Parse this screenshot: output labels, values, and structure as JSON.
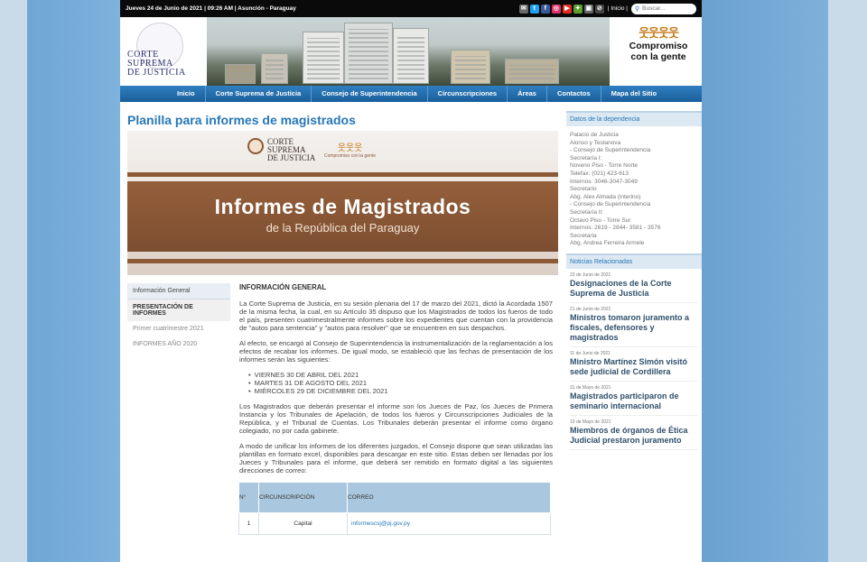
{
  "topbar": {
    "date": "Jueves 24 de Junio de 2021 | 09:26 AM | Asunción - Paraguay",
    "inicio": "| Inicio |",
    "search_placeholder": "Buscar..."
  },
  "social_icons": [
    {
      "name": "mail-icon",
      "color": "#6a6a6a",
      "glyph": "✉"
    },
    {
      "name": "twitter-icon",
      "color": "#1da1f2",
      "glyph": "t"
    },
    {
      "name": "facebook-icon",
      "color": "#3b5998",
      "glyph": "f"
    },
    {
      "name": "instagram-icon",
      "color": "#e1306c",
      "glyph": "◎"
    },
    {
      "name": "youtube-icon",
      "color": "#e52d27",
      "glyph": "▶"
    },
    {
      "name": "app-icon",
      "color": "#5aa02c",
      "glyph": "✦"
    },
    {
      "name": "camera-icon",
      "color": "#666666",
      "glyph": "▣"
    },
    {
      "name": "link-icon",
      "color": "#444444",
      "glyph": "⊘"
    }
  ],
  "header": {
    "logo_line1": "CORTE",
    "logo_line2": "SUPREMA",
    "logo_line3": "DE JUSTICIA",
    "slogan_line1": "Compromiso",
    "slogan_line2": "con la gente"
  },
  "nav": {
    "items": [
      "Inicio",
      "Corte Suprema de Justicia",
      "Consejo de Superintendencia",
      "Circunscripciones",
      "Áreas",
      "Contactos",
      "Mapa del Sitio"
    ]
  },
  "page_title": "Planilla para informes de magistrados",
  "banner": {
    "logo_line1": "CORTE",
    "logo_line2": "SUPREMA",
    "logo_line3": "DE JUSTICIA",
    "slogan": "Compromiso con la gente",
    "heading": "Informes de Magistrados",
    "subheading": "de la República del Paraguay"
  },
  "left_menu": [
    "Información General",
    "PRESENTACIÓN DE INFORMES",
    "Primer cuatrimestre 2021",
    "INFORMES AÑO 2020"
  ],
  "content": {
    "heading": "INFORMACIÓN GENERAL",
    "p1": "La Corte Suprema de Justicia, en su sesión plenaria del 17 de marzo del 2021, dictó la Acordada 1507 de la misma fecha, la cual, en su Artículo 35 dispuso que los Magistrados de todos los fueros de todo el país, presenten cuatrimestralmente informes sobre los expedientes que cuentan con la providencia de \"autos para sentencia\" y \"autos para resolver\" que se encuentren en sus despachos.",
    "p2": "Al efecto, se encargó al Consejo de Superintendencia la instrumentalización de la reglamentación a los efectos de recabar los informes. De igual modo, se estableció que las fechas de presentación de los informes serán las siguientes:",
    "dates": [
      "VIERNES 30 DE ABRIL DEL 2021",
      "MARTES 31 DE AGOSTO DEL 2021",
      "MIÉRCOLES 29 DE DICIEMBRE DEL 2021"
    ],
    "p3": "Los Magistrados que deberán presentar el informe son los Jueces de Paz, los Jueces de Primera Instancia y los Tribunales de Apelación, de todos los fueros y Circunscripciones Judiciales de la República, y el Tribunal de Cuentas. Los Tribunales deberán presentar el informe como órgano colegiado, no por cada gabinete.",
    "p4": "A modo de unificar los informes de los diferentes juzgados, el Consejo dispone que sean utilizadas las plantillas en formato excel, disponibles para descargar en este sitio. Estas deben ser llenadas por los Jueces y Tribunales para el informe, que deberá ser remitido en formato digital a las siguientes direcciones de correo:"
  },
  "table": {
    "headers": [
      "N°",
      "CIRCUNSCRIPCIÓN",
      "CORREO"
    ],
    "rows": [
      {
        "n": "1",
        "circ": "Capital",
        "mail": "informescsj@pj.gov.py"
      }
    ]
  },
  "sidebar": {
    "dependencia_title": "Datos de la dependencia",
    "dependencia_lines": [
      "Palacio de Justicia",
      "Alonso y Testanova",
      "- Consejo de Superintendencia",
      "Secretaría I:",
      "Noveno Piso - Torre Norte",
      "Telefax: (021) 423-613",
      "Internos: 3046-3047-3049",
      "Secretario",
      "Abg. Alex Almada (interino)",
      "- Consejo de Superintendencia",
      "Secretaría II:",
      "Octavo Piso - Torre Sur",
      "Internos: 2619 - 2844- 3581 - 3576",
      "Secretaria",
      "Abg. Andrea Ferreira Armele"
    ],
    "news_title": "Noticias Relacionadas",
    "news": [
      {
        "date": "23 de Junio de 2021",
        "title": "Designaciones de la Corte Suprema de Justicia"
      },
      {
        "date": "21 de Junio de 2021",
        "title": "Ministros tomaron juramento a fiscales, defensores y magistrados"
      },
      {
        "date": "11 de Junio de 2021",
        "title": "Ministro Martínez Simón visitó sede judicial de Cordillera"
      },
      {
        "date": "31 de Mayo de 2021",
        "title": "Magistrados participaron de seminario internacional"
      },
      {
        "date": "10 de Mayo de 2021",
        "title": "Miembros de órganos de Ética Judicial prestaron juramento"
      }
    ]
  }
}
